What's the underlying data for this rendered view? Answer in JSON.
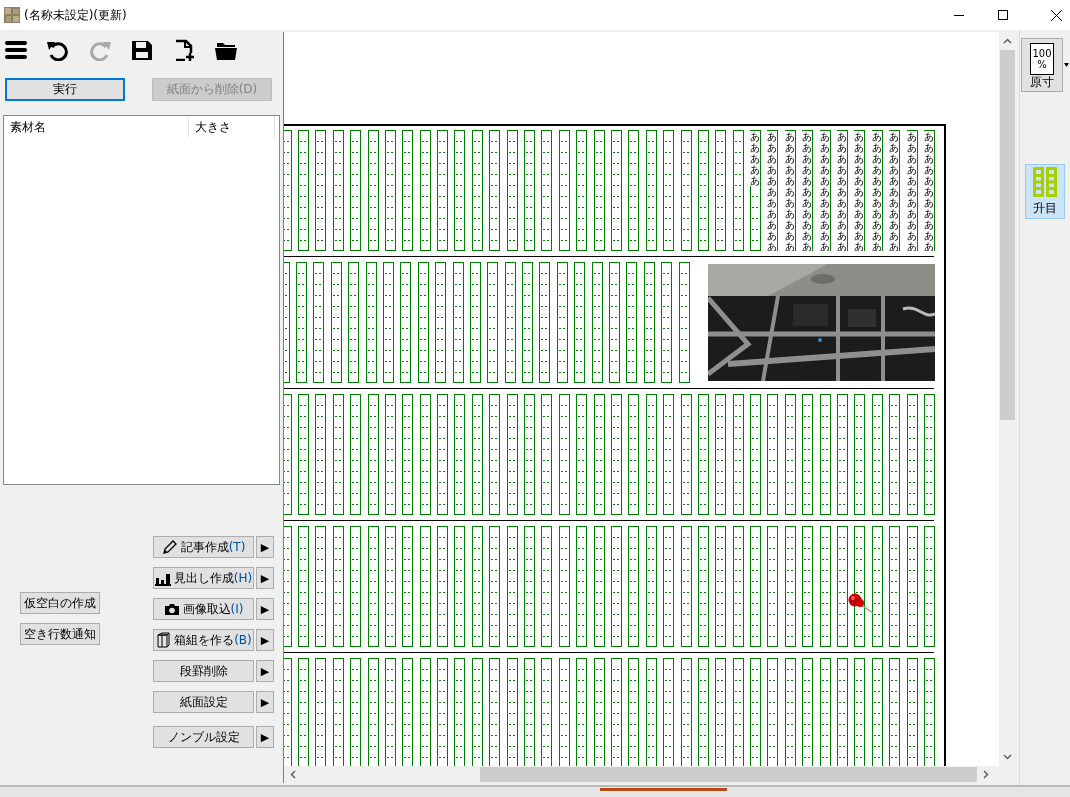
{
  "window": {
    "title": "(名称未設定)(更新)"
  },
  "toolbar": [
    {
      "kind": "menu",
      "disabled": false
    },
    {
      "kind": "undo",
      "disabled": false
    },
    {
      "kind": "redo",
      "disabled": true
    },
    {
      "kind": "save",
      "disabled": false
    },
    {
      "kind": "new",
      "disabled": false
    },
    {
      "kind": "open",
      "disabled": false
    }
  ],
  "actions": [
    {
      "label": "実行",
      "focused": true,
      "disabled": false
    },
    {
      "label": "紙面から削除(D)",
      "focused": false,
      "disabled": true
    }
  ],
  "material_list": {
    "columns": [
      "素材名",
      "大きさ"
    ]
  },
  "side_buttons": [
    "仮空白の作成",
    "空き行数通知"
  ],
  "tool_buttons": [
    {
      "kind": "pencil",
      "label": "記事作成",
      "shortcut": "(T)",
      "arrow": "▶"
    },
    {
      "kind": "chart",
      "label": "見出し作成",
      "shortcut": "(H)",
      "arrow": "▶"
    },
    {
      "kind": "camera",
      "label": "画像取込",
      "shortcut": "(I)",
      "arrow": "▶"
    },
    {
      "kind": "box",
      "label": "箱組を作る",
      "shortcut": "(B)",
      "arrow": "▶"
    },
    {
      "kind": "plain",
      "label": "段罫削除",
      "arrow": "▶"
    },
    {
      "kind": "plain",
      "label": "紙面設定",
      "arrow": "▶"
    },
    {
      "kind": "plain",
      "label": "ノンブル設定",
      "arrow": "▶"
    }
  ],
  "layout": {
    "pushpin": true,
    "bands": [
      {
        "kind": "text",
        "text_columns": [
          "あああああ",
          "あああああああああああ",
          "あああああああああああ",
          "あああああああああああ",
          "あああああああああああ",
          "あああああああああああ",
          "あああああああああああ",
          "あああああああああああ",
          "あああああああああああ",
          "あああああああああああ",
          "あああああああああああ"
        ]
      },
      {
        "kind": "picture"
      },
      {
        "kind": "blank"
      },
      {
        "kind": "blank"
      },
      {
        "kind": "blank"
      }
    ]
  },
  "zoom_button": {
    "value": "100",
    "unit": "%",
    "label": "原寸"
  },
  "grid_button": {
    "label": "升目",
    "selected": true
  }
}
